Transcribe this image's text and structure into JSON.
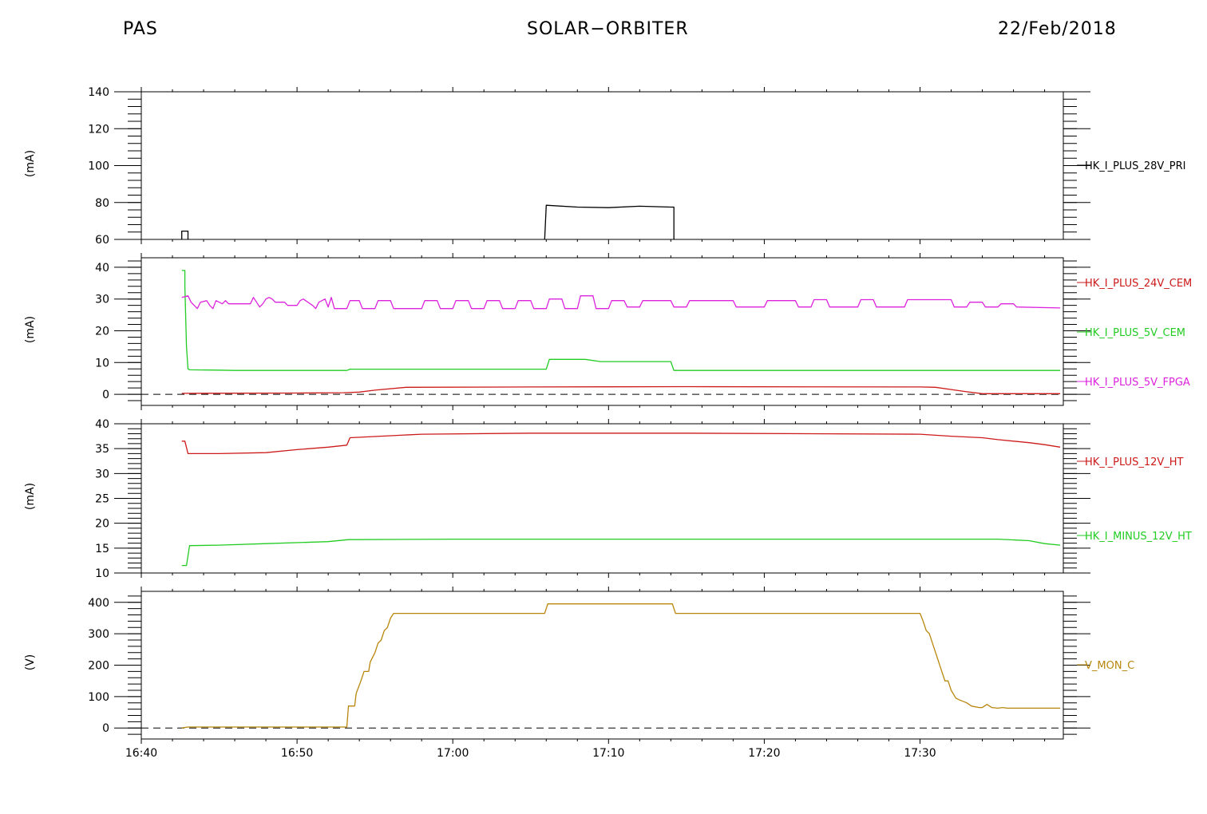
{
  "header": {
    "instrument": "PAS",
    "mission": "SOLAR−ORBITER",
    "date": "22/Feb/2018"
  },
  "colors": {
    "black": "#000000",
    "red": "#cc1a1a",
    "green": "#22cc22",
    "magenta": "#dd22dd",
    "orange": "#b8860b"
  },
  "chart_data": [
    {
      "type": "line",
      "id": "panel1",
      "ylabel": "(mA)",
      "ylim": [
        60,
        140
      ],
      "yticks": [
        60,
        80,
        100,
        120,
        140
      ],
      "ytick_labels": [
        "60",
        "80",
        "100",
        "120",
        "140"
      ],
      "x_unit": "minutes after 16:40",
      "xlim": [
        0,
        59.2
      ],
      "series": [
        {
          "name": "HK_I_PLUS_28V_PRI",
          "color": "black",
          "x": [
            2.6,
            2.6,
            2.9,
            3.0,
            3.0,
            null,
            25.9,
            26.0,
            28.0,
            30.0,
            32.0,
            34.0,
            34.2,
            34.2
          ],
          "y": [
            60,
            64.5,
            64.5,
            64.5,
            60,
            null,
            60,
            78.5,
            77.5,
            77.2,
            78,
            77.5,
            77.5,
            60
          ]
        }
      ]
    },
    {
      "type": "line",
      "id": "panel2",
      "ylabel": "(mA)",
      "ylim": [
        -3.5,
        43
      ],
      "yticks": [
        0,
        10,
        20,
        30,
        40
      ],
      "ytick_labels": [
        "0",
        "10",
        "20",
        "30",
        "40"
      ],
      "zero_line": true,
      "series": [
        {
          "name": "HK_I_PLUS_24V_CEM",
          "color": "red",
          "x": [
            2.6,
            10,
            13,
            14,
            15,
            17,
            25,
            35,
            50,
            51,
            52,
            53,
            54,
            56,
            59
          ],
          "y": [
            0.3,
            0.4,
            0.5,
            0.7,
            1.3,
            2.2,
            2.3,
            2.4,
            2.3,
            2.2,
            1.5,
            0.8,
            0.2,
            0.2,
            0.2
          ]
        },
        {
          "name": "HK_I_PLUS_5V_CEM",
          "color": "green",
          "x": [
            2.6,
            2.8,
            2.8,
            2.9,
            3.0,
            3.1,
            5,
            6,
            13.2,
            13.4,
            26.0,
            26.2,
            28.5,
            29.5,
            34.0,
            34.2,
            59
          ],
          "y": [
            39,
            39,
            34,
            15,
            8,
            7.7,
            7.6,
            7.5,
            7.5,
            7.9,
            7.9,
            11,
            11,
            10.3,
            10.3,
            7.5,
            7.5
          ]
        },
        {
          "name": "HK_I_PLUS_5V_FPGA",
          "color": "magenta",
          "x": [
            2.6,
            3.0,
            3.2,
            3.4,
            3.6,
            3.8,
            4.2,
            4.4,
            4.6,
            4.8,
            5.0,
            5.2,
            5.4,
            5.6,
            7.0,
            7.2,
            7.4,
            7.6,
            7.8,
            8.0,
            8.2,
            8.4,
            8.6,
            9.2,
            9.4,
            10.0,
            10.2,
            10.4,
            11.0,
            11.2,
            11.4,
            11.6,
            11.8,
            12.0,
            12.2,
            12.4,
            12.6,
            13.2,
            13.4,
            14.0,
            14.2,
            15.0,
            15.2,
            16.0,
            16.2,
            18.0,
            18.2,
            19.0,
            19.2,
            20.0,
            20.2,
            21.0,
            21.2,
            22.0,
            22.2,
            23.0,
            23.2,
            24.0,
            24.2,
            25.0,
            25.2,
            26.0,
            26.2,
            27.0,
            27.2,
            28.0,
            28.2,
            29.0,
            29.2,
            30.0,
            30.2,
            31.0,
            31.2,
            32.0,
            32.2,
            34.0,
            34.2,
            35.0,
            35.2,
            38.0,
            38.2,
            40.0,
            40.2,
            42.0,
            42.2,
            43.0,
            43.2,
            44.0,
            44.2,
            46.0,
            46.2,
            47.0,
            47.2,
            49.0,
            49.2,
            52.0,
            52.2,
            53.0,
            53.2,
            54.0,
            54.2,
            55.0,
            55.2,
            56.0,
            56.2,
            59
          ],
          "y": [
            30.5,
            31,
            29,
            28,
            27,
            29,
            29.5,
            28,
            27,
            29.5,
            29,
            28.5,
            29.5,
            28.5,
            28.5,
            30.5,
            29,
            27.5,
            28.5,
            30,
            30.5,
            30,
            29,
            29,
            28,
            28,
            29.5,
            30,
            28,
            27,
            29,
            29.5,
            30,
            27.5,
            30.5,
            27,
            27,
            27,
            29.5,
            29.5,
            27,
            27,
            29.5,
            29.5,
            27,
            27,
            29.5,
            29.5,
            27,
            27,
            29.5,
            29.5,
            27,
            27,
            29.5,
            29.5,
            27,
            27,
            29.5,
            29.5,
            27,
            27,
            30,
            30,
            27,
            27,
            31,
            31,
            27,
            27,
            29.5,
            29.5,
            27.5,
            27.5,
            29.5,
            29.5,
            27.5,
            27.5,
            29.5,
            29.5,
            27.5,
            27.5,
            29.5,
            29.5,
            27.5,
            27.5,
            29.8,
            29.8,
            27.5,
            27.5,
            29.8,
            29.8,
            27.5,
            27.5,
            29.8,
            29.8,
            27.5,
            27.5,
            29,
            29,
            27.5,
            27.5,
            28.5,
            28.5,
            27.5,
            27.2
          ]
        }
      ]
    },
    {
      "type": "line",
      "id": "panel3",
      "ylabel": "(mA)",
      "ylim": [
        10,
        40
      ],
      "yticks": [
        10,
        15,
        20,
        25,
        30,
        35,
        40
      ],
      "ytick_labels": [
        "10",
        "15",
        "20",
        "25",
        "30",
        "35",
        "40"
      ],
      "series": [
        {
          "name": "HK_I_PLUS_12V_HT",
          "color": "red",
          "x": [
            2.6,
            2.8,
            3.0,
            5,
            8,
            10,
            12,
            13.2,
            13.4,
            16,
            18,
            25,
            35,
            50,
            52,
            54,
            55,
            57,
            58,
            59
          ],
          "y": [
            36.5,
            36.5,
            34,
            34,
            34.2,
            34.8,
            35.3,
            35.7,
            37.2,
            37.6,
            37.9,
            38.1,
            38.1,
            37.9,
            37.5,
            37.2,
            36.8,
            36.2,
            35.8,
            35.3
          ]
        },
        {
          "name": "HK_I_MINUS_12V_HT",
          "color": "green",
          "x": [
            2.6,
            2.9,
            3.1,
            5,
            8,
            12,
            13.3,
            20,
            35,
            55,
            57,
            58,
            59
          ],
          "y": [
            11.5,
            11.5,
            15.5,
            15.6,
            15.9,
            16.3,
            16.7,
            16.8,
            16.8,
            16.8,
            16.5,
            15.9,
            15.6
          ]
        }
      ]
    },
    {
      "type": "line",
      "id": "panel4",
      "ylabel": "(V)",
      "ylim": [
        -35,
        435
      ],
      "yticks": [
        0,
        100,
        200,
        300,
        400
      ],
      "ytick_labels": [
        "0",
        "100",
        "200",
        "300",
        "400"
      ],
      "zero_line": true,
      "series": [
        {
          "name": "V_MON_C",
          "color": "orange",
          "x": [
            2.6,
            3.0,
            13.2,
            13.3,
            13.7,
            13.8,
            14.1,
            14.3,
            14.6,
            14.7,
            15.0,
            15.2,
            15.4,
            15.6,
            15.8,
            16.0,
            16.2,
            16.4,
            16.6,
            16.8,
            17.0,
            25.9,
            26.1,
            34.1,
            34.3,
            50.0,
            50.2,
            50.4,
            50.6,
            50.8,
            51.0,
            51.2,
            51.4,
            51.6,
            51.8,
            52.0,
            52.3,
            52.5,
            53.0,
            53.3,
            53.8,
            54.0,
            54.3,
            54.6,
            55.0,
            55.3,
            55.6,
            59
          ],
          "y": [
            0,
            3,
            3,
            70,
            70,
            110,
            150,
            180,
            180,
            210,
            240,
            270,
            280,
            310,
            320,
            350,
            365,
            365,
            365,
            365,
            365,
            365,
            395,
            395,
            365,
            365,
            340,
            310,
            300,
            270,
            240,
            210,
            180,
            150,
            150,
            120,
            95,
            90,
            80,
            70,
            65,
            65,
            75,
            65,
            63,
            65,
            63,
            63
          ]
        }
      ]
    }
  ],
  "xaxis": {
    "ticks": [
      0,
      10,
      20,
      30,
      40,
      50
    ],
    "tick_labels": [
      "16:40",
      "16:50",
      "17:00",
      "17:10",
      "17:20",
      "17:30"
    ]
  }
}
